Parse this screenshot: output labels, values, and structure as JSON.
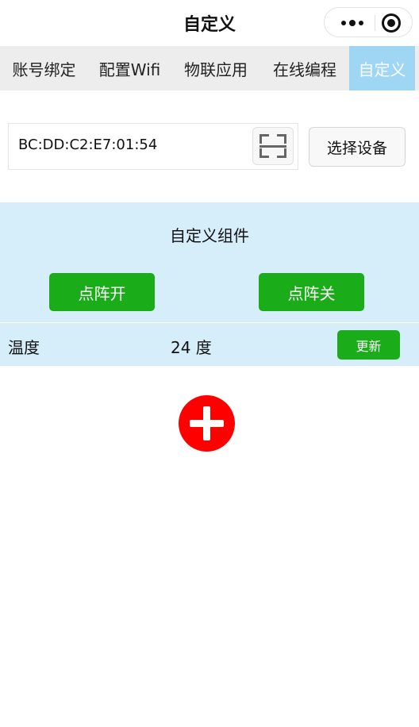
{
  "navbar": {
    "title": "自定义",
    "more_icon": "more-dots-icon",
    "close_icon": "target-circle-icon"
  },
  "tabs": [
    {
      "label": "账号绑定",
      "active": false
    },
    {
      "label": "配置Wifi",
      "active": false
    },
    {
      "label": "物联应用",
      "active": false
    },
    {
      "label": "在线编程",
      "active": false
    },
    {
      "label": "自定义",
      "active": true
    }
  ],
  "device": {
    "id_value": "BC:DD:C2:E7:01:54",
    "scan_icon": "scan-qr-icon",
    "select_label": "选择设备"
  },
  "panel": {
    "title": "自定义组件",
    "button_on": "点阵开",
    "button_off": "点阵关",
    "temperature_label": "温度",
    "temperature_value": "24 度",
    "update_label": "更新"
  },
  "add_button": {
    "icon": "plus-icon"
  },
  "colors": {
    "tab_active_bg": "#9fd6f3",
    "panel_bg": "#d6eefa",
    "button_green": "#1aac19",
    "add_red": "#ff0000"
  }
}
